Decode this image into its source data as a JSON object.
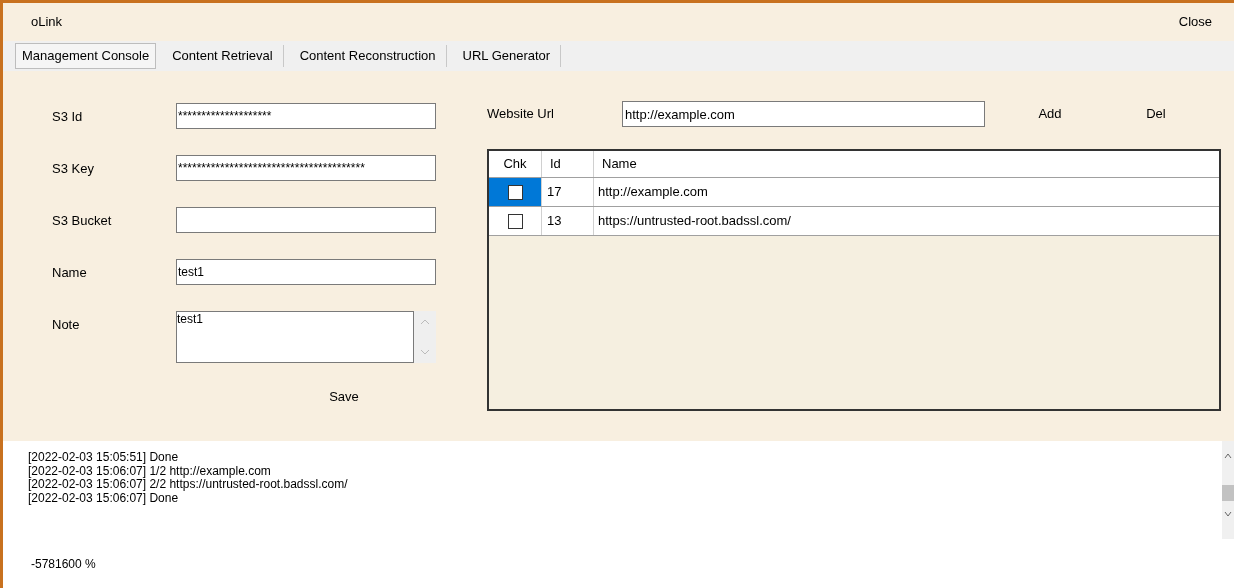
{
  "window": {
    "title": "oLink",
    "close_label": "Close"
  },
  "tabs": [
    {
      "label": "Management Console",
      "selected": true
    },
    {
      "label": "Content Retrieval",
      "selected": false
    },
    {
      "label": "Content Reconstruction",
      "selected": false
    },
    {
      "label": "URL Generator",
      "selected": false
    }
  ],
  "form": {
    "fields": [
      {
        "label": "S3 Id",
        "value": "********************",
        "kind": "line"
      },
      {
        "label": "S3 Key",
        "value": "****************************************",
        "kind": "line"
      },
      {
        "label": "S3 Bucket",
        "kind": "line"
      },
      {
        "label": "Name",
        "value": "test1",
        "kind": "line"
      },
      {
        "label": "Note",
        "value": "test1",
        "kind": "multiline"
      }
    ],
    "save_label": "Save"
  },
  "website": {
    "label": "Website Url",
    "value": "http://example.com",
    "add_label": "Add",
    "del_label": "Del"
  },
  "table": {
    "columns": [
      "Chk",
      "Id",
      "Name"
    ],
    "rows": [
      {
        "checked": false,
        "selected": true,
        "id": "17",
        "name": "http://example.com"
      },
      {
        "checked": false,
        "selected": false,
        "id": "13",
        "name": "https://untrusted-root.badssl.com/"
      }
    ]
  },
  "log": [
    "[2022-02-03 15:05:51] Done",
    "[2022-02-03 15:06:07] 1/2 http://example.com",
    "[2022-02-03 15:06:07] 2/2 https://untrusted-root.badssl.com/",
    "[2022-02-03 15:06:07] Done"
  ],
  "status": "-5781600 %"
}
